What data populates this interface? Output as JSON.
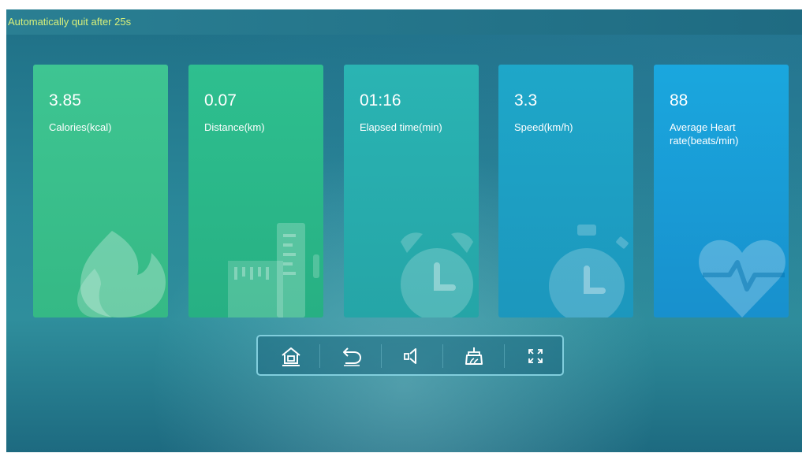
{
  "status": {
    "auto_quit_text": "Automatically quit after 25s"
  },
  "cards": [
    {
      "value": "3.85",
      "label": "Calories(kcal)",
      "icon": "flame-icon",
      "color": "#3ec592"
    },
    {
      "value": "0.07",
      "label": "Distance(km)",
      "icon": "ruler-icon",
      "color": "#2ebf8f"
    },
    {
      "value": "01:16",
      "label": "Elapsed time(min)",
      "icon": "alarm-clock-icon",
      "color": "#2ab4b3"
    },
    {
      "value": "3.3",
      "label": "Speed(km/h)",
      "icon": "stopwatch-icon",
      "color": "#1ea7c9"
    },
    {
      "value": "88",
      "label": "Average Heart rate(beats/min)",
      "icon": "heart-pulse-icon",
      "color": "#1aa7de"
    }
  ],
  "toolbar": {
    "buttons": [
      {
        "icon": "home-icon"
      },
      {
        "icon": "back-icon"
      },
      {
        "icon": "volume-icon"
      },
      {
        "icon": "clean-brush-icon"
      },
      {
        "icon": "fullscreen-icon"
      }
    ],
    "accent_color": "#8cd7e6"
  },
  "theme": {
    "status_text_color": "#d8f07a",
    "background": "#2a8799"
  }
}
